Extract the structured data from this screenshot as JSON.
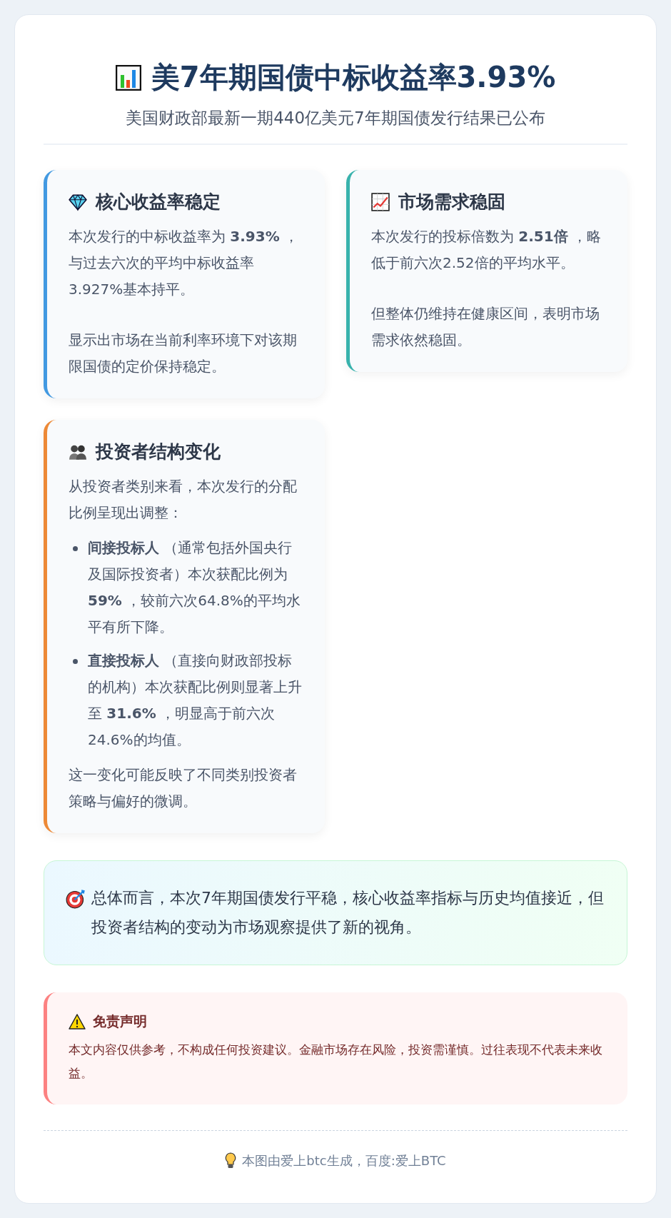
{
  "header": {
    "title": "美7年期国债中标收益率3.93%",
    "subtitle": "美国财政部最新一期440亿美元7年期国债发行结果已公布"
  },
  "cards": [
    {
      "title": "核心收益率稳定",
      "color": "#4299e1",
      "blocks": [
        {
          "kind": "p",
          "text": "本次发行的中标收益率为 **3.93%** ，与过去六次的平均中标收益率3.927%基本持平。"
        },
        {
          "kind": "p",
          "text": "显示出市场在当前利率环境下对该期限国债的定价保持稳定。"
        }
      ]
    },
    {
      "title": "市场需求稳固",
      "color": "#38b2ac",
      "blocks": [
        {
          "kind": "p",
          "text": "本次发行的投标倍数为 **2.51倍** ，略低于前六次2.52倍的平均水平。"
        },
        {
          "kind": "p",
          "text": "但整体仍维持在健康区间，表明市场需求依然稳固。"
        }
      ]
    },
    {
      "title": "投资者结构变化",
      "color": "#ed8936",
      "blocks": [
        {
          "kind": "p",
          "text": "从投资者类别来看，本次发行的分配比例呈现出调整："
        },
        {
          "kind": "list",
          "items": [
            "**间接投标人** （通常包括外国央行及国际投资者）本次获配比例为 **59%** ，较前六次64.8%的平均水平有所下降。",
            "**直接投标人** （直接向财政部投标的机构）本次获配比例则显著上升至 **31.6%** ，明显高于前六次24.6%的均值。"
          ]
        },
        {
          "kind": "p",
          "text": "这一变化可能反映了不同类别投资者策略与偏好的微调。"
        }
      ]
    }
  ],
  "summary": "总体而言，本次7年期国债发行平稳，核心收益率指标与历史均值接近，但投资者结构的变动为市场观察提供了新的视角。",
  "disclaimer": {
    "title": "免责声明",
    "text": "本文内容仅供参考，不构成任何投资建议。金融市场存在风险，投资需谨慎。过往表现不代表未来收益。"
  },
  "footer": "本图由爱上btc生成，百度:爱上BTC"
}
